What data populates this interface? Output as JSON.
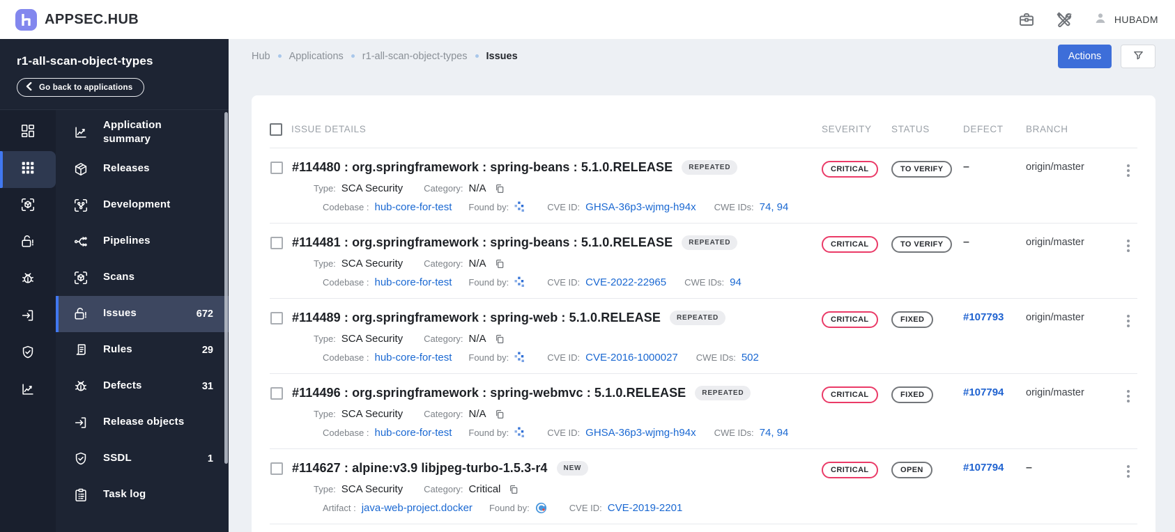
{
  "header": {
    "logo_text": "APPSEC.HUB",
    "user_name": "HUBADM"
  },
  "sidebar": {
    "app_title": "r1-all-scan-object-types",
    "back_button_label": "Go back to applications",
    "rail": [
      {
        "icon": "dashboard-icon",
        "active": false
      },
      {
        "icon": "apps-grid-icon",
        "active": true
      },
      {
        "icon": "scan-cube-icon",
        "active": false
      },
      {
        "icon": "lock-alert-icon",
        "active": false
      },
      {
        "icon": "bug-icon",
        "active": false
      },
      {
        "icon": "exit-icon",
        "active": false
      },
      {
        "icon": "shield-check-icon",
        "active": false
      },
      {
        "icon": "chart-line-icon",
        "active": false
      }
    ],
    "menu": [
      {
        "icon": "chart-line-icon",
        "label": "Application summary",
        "count": "",
        "active": false
      },
      {
        "icon": "package-icon",
        "label": "Releases",
        "count": "",
        "active": false
      },
      {
        "icon": "dev-branch-icon",
        "label": "Development",
        "count": "",
        "active": false
      },
      {
        "icon": "pipelines-icon",
        "label": "Pipelines",
        "count": "",
        "active": false
      },
      {
        "icon": "scan-cube-icon",
        "label": "Scans",
        "count": "",
        "active": false
      },
      {
        "icon": "lock-alert-icon",
        "label": "Issues",
        "count": "672",
        "active": true
      },
      {
        "icon": "rules-icon",
        "label": "Rules",
        "count": "29",
        "active": false
      },
      {
        "icon": "bug-icon",
        "label": "Defects",
        "count": "31",
        "active": false
      },
      {
        "icon": "exit-icon",
        "label": "Release objects",
        "count": "",
        "active": false
      },
      {
        "icon": "shield-check-icon",
        "label": "SSDL",
        "count": "1",
        "active": false
      },
      {
        "icon": "clipboard-icon",
        "label": "Task log",
        "count": "",
        "active": false
      }
    ]
  },
  "breadcrumb": [
    "Hub",
    "Applications",
    "r1-all-scan-object-types",
    "Issues"
  ],
  "toolbar": {
    "actions_label": "Actions"
  },
  "table": {
    "columns": {
      "details": "ISSUE DETAILS",
      "severity": "SEVERITY",
      "status": "STATUS",
      "defect": "DEFECT",
      "branch": "BRANCH"
    },
    "rows": [
      {
        "title": "#114480 : org.springframework : spring-beans : 5.1.0.RELEASE",
        "badge": "REPEATED",
        "type_label": "Type:",
        "type_value": "SCA Security",
        "category_label": "Category:",
        "category_value": "N/A",
        "source_label": "Codebase :",
        "source_value": "hub-core-for-test",
        "found_by_label": "Found by:",
        "found_by_icon": "dependency-scanner-icon",
        "cve_label": "CVE ID:",
        "cve_value": "GHSA-36p3-wjmg-h94x",
        "cwe_label": "CWE IDs:",
        "cwe_value": "74, 94",
        "severity": "CRITICAL",
        "status": "TO VERIFY",
        "defect": "–",
        "branch": "origin/master"
      },
      {
        "title": "#114481 : org.springframework : spring-beans : 5.1.0.RELEASE",
        "badge": "REPEATED",
        "type_label": "Type:",
        "type_value": "SCA Security",
        "category_label": "Category:",
        "category_value": "N/A",
        "source_label": "Codebase :",
        "source_value": "hub-core-for-test",
        "found_by_label": "Found by:",
        "found_by_icon": "dependency-scanner-icon",
        "cve_label": "CVE ID:",
        "cve_value": "CVE-2022-22965",
        "cwe_label": "CWE IDs:",
        "cwe_value": "94",
        "severity": "CRITICAL",
        "status": "TO VERIFY",
        "defect": "–",
        "branch": "origin/master"
      },
      {
        "title": "#114489 : org.springframework : spring-web : 5.1.0.RELEASE",
        "badge": "REPEATED",
        "type_label": "Type:",
        "type_value": "SCA Security",
        "category_label": "Category:",
        "category_value": "N/A",
        "source_label": "Codebase :",
        "source_value": "hub-core-for-test",
        "found_by_label": "Found by:",
        "found_by_icon": "dependency-scanner-icon",
        "cve_label": "CVE ID:",
        "cve_value": "CVE-2016-1000027",
        "cwe_label": "CWE IDs:",
        "cwe_value": "502",
        "severity": "CRITICAL",
        "status": "FIXED",
        "defect": "#107793",
        "branch": "origin/master"
      },
      {
        "title": "#114496 : org.springframework : spring-webmvc : 5.1.0.RELEASE",
        "badge": "REPEATED",
        "type_label": "Type:",
        "type_value": "SCA Security",
        "category_label": "Category:",
        "category_value": "N/A",
        "source_label": "Codebase :",
        "source_value": "hub-core-for-test",
        "found_by_label": "Found by:",
        "found_by_icon": "dependency-scanner-icon",
        "cve_label": "CVE ID:",
        "cve_value": "GHSA-36p3-wjmg-h94x",
        "cwe_label": "CWE IDs:",
        "cwe_value": "74, 94",
        "severity": "CRITICAL",
        "status": "FIXED",
        "defect": "#107794",
        "branch": "origin/master"
      },
      {
        "title": "#114627 : alpine:v3.9 libjpeg-turbo-1.5.3-r4",
        "badge": "NEW",
        "type_label": "Type:",
        "type_value": "SCA Security",
        "category_label": "Category:",
        "category_value": "Critical",
        "source_label": "Artifact :",
        "source_value": "java-web-project.docker",
        "found_by_label": "Found by:",
        "found_by_icon": "anchore-scanner-icon",
        "cve_label": "CVE ID:",
        "cve_value": "CVE-2019-2201",
        "cwe_label": "",
        "cwe_value": "",
        "severity": "CRITICAL",
        "status": "OPEN",
        "defect": "#107794",
        "branch": "–"
      }
    ]
  },
  "colors": {
    "accent_blue": "#3d6ed9",
    "link_blue": "#1a68d2",
    "critical_red": "#ea3a67",
    "sidebar_active_blue": "#4178f0",
    "sidebar_bg": "#1d2433"
  }
}
